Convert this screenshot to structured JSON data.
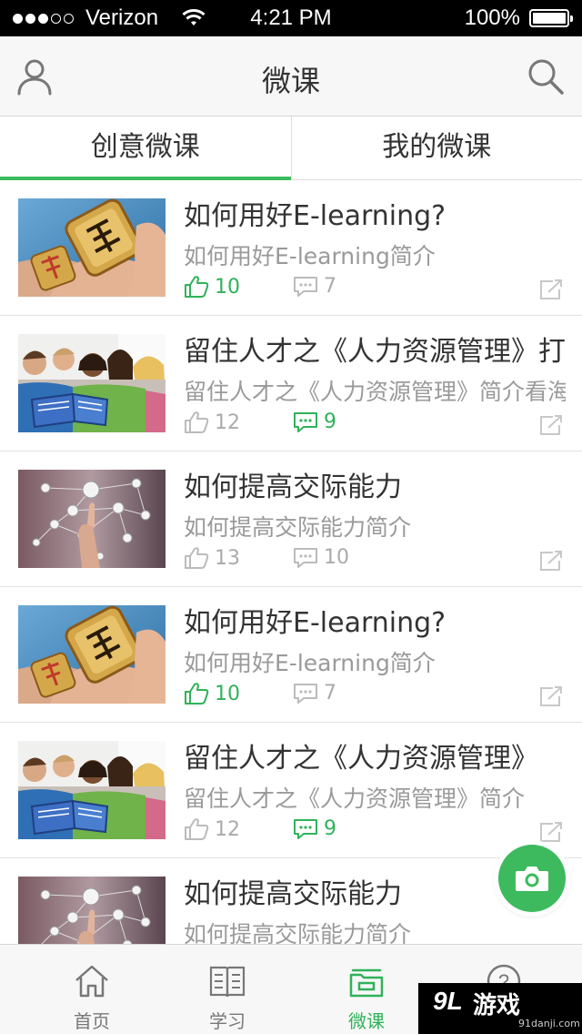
{
  "status_bar": {
    "carrier": "Verizon",
    "time": "4:21 PM",
    "battery": "100%"
  },
  "nav": {
    "title": "微课",
    "left_icon": "user-icon",
    "right_icon": "search-icon"
  },
  "tabs": [
    {
      "label": "创意微课",
      "active": true
    },
    {
      "label": "我的微课",
      "active": false
    }
  ],
  "courses": [
    {
      "title": "如何用好E-learning?",
      "desc": "如何用好E-learning简介",
      "likes": "10",
      "comments": "7",
      "liked": true,
      "commented": false,
      "image": "chess-piece"
    },
    {
      "title": "留住人才之《人力资源管理》打",
      "desc": "留住人才之《人力资源管理》简介看海",
      "likes": "12",
      "comments": "9",
      "liked": false,
      "commented": true,
      "image": "students"
    },
    {
      "title": "如何提高交际能力",
      "desc": "如何提高交际能力简介",
      "likes": "13",
      "comments": "10",
      "liked": false,
      "commented": false,
      "image": "network"
    },
    {
      "title": "如何用好E-learning?",
      "desc": "如何用好E-learning简介",
      "likes": "10",
      "comments": "7",
      "liked": true,
      "commented": false,
      "image": "chess-piece"
    },
    {
      "title": "留住人才之《人力资源管理》",
      "desc": "留住人才之《人力资源管理》简介",
      "likes": "12",
      "comments": "9",
      "liked": false,
      "commented": true,
      "image": "students"
    },
    {
      "title": "如何提高交际能力",
      "desc": "如何提高交际能力简介",
      "likes": "",
      "comments": "",
      "liked": false,
      "commented": false,
      "image": "network"
    }
  ],
  "tab_bar": [
    {
      "label": "首页",
      "icon": "home-icon",
      "active": false
    },
    {
      "label": "学习",
      "icon": "book-icon",
      "active": false
    },
    {
      "label": "微课",
      "icon": "folder-icon",
      "active": true
    },
    {
      "label": "",
      "icon": "help-icon",
      "active": false
    }
  ],
  "fab_icon": "camera-icon",
  "watermark": {
    "logo": "9L",
    "text": "游戏",
    "url": "91danji.com"
  },
  "colors": {
    "accent": "#3dba5e",
    "accent_text": "#2fb25a"
  }
}
